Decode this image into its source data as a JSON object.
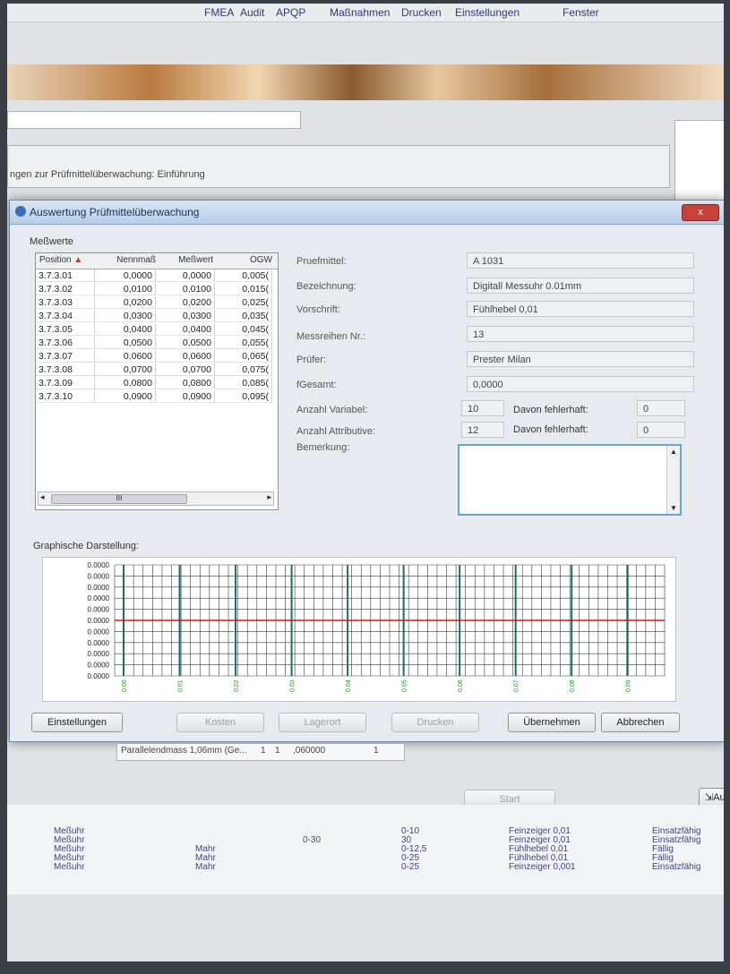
{
  "menubar": {
    "items": [
      "Fenster",
      "Einstellungen",
      "Drucken",
      "Maßnahmen",
      "APQP",
      "Audit",
      "FMEA"
    ]
  },
  "background": {
    "intro_text": "ngen zur Prüfmittelüberwachung: Einführung",
    "row_text": "Parallelendmass 1,06mm (Ge...",
    "row_cols": [
      "1",
      "1",
      ",060000",
      "1"
    ],
    "start_button": "Start",
    "aus_button": "Aus",
    "list_rows": [
      [
        "Meßuhr",
        "",
        "",
        "0-10",
        "Feinzeiger 0,01",
        "Einsatzfähig"
      ],
      [
        "Meßuhr",
        "",
        "0-30",
        "30",
        "Feinzeiger 0,01",
        "Einsatzfähig"
      ],
      [
        "Meßuhr",
        "Mahr",
        "",
        "0-12,5",
        "Fühlhebel 0,01",
        "Fällig"
      ],
      [
        "Meßuhr",
        "Mahr",
        "",
        "0-25",
        "Fühlhebel 0,01",
        "Fällig"
      ],
      [
        "Meßuhr",
        "Mahr",
        "",
        "0-25",
        "Feinzeiger 0,001",
        "Einsatzfähig"
      ]
    ]
  },
  "dialog": {
    "title": "Auswertung Prüfmittelüberwachung",
    "close_label": "x",
    "messwerte_label": "Meßwerte",
    "columns": [
      "Position",
      "Nennmaß",
      "Meßwert",
      "OGW"
    ],
    "rows": [
      [
        "3.7.3.01",
        "0,0000",
        "0,0000",
        "0,005("
      ],
      [
        "3.7.3.02",
        "0,0100",
        "0,0100",
        "0,015("
      ],
      [
        "3.7.3.03",
        "0,0200",
        "0,0200",
        "0,025("
      ],
      [
        "3.7.3.04",
        "0,0300",
        "0,0300",
        "0,035("
      ],
      [
        "3.7.3.05",
        "0,0400",
        "0,0400",
        "0,045("
      ],
      [
        "3.7.3.06",
        "0,0500",
        "0,0500",
        "0,055("
      ],
      [
        "3.7.3.07",
        "0,0600",
        "0,0600",
        "0,065("
      ],
      [
        "3.7.3.08",
        "0,0700",
        "0,0700",
        "0,075("
      ],
      [
        "3.7.3.09",
        "0,0800",
        "0,0800",
        "0,085("
      ],
      [
        "3.7.3.10",
        "0,0900",
        "0,0900",
        "0,095("
      ]
    ],
    "scroll_thumb": "III",
    "fields": {
      "pruefmittel_label": "Pruefmittel:",
      "pruefmittel": "A 1031",
      "bezeichnung_label": "Bezeichnung:",
      "bezeichnung": "Digitall Messuhr 0.01mm",
      "vorschrift_label": "Vorschrift:",
      "vorschrift": "Fühlhebel 0,01",
      "messreihe_label": "Messreihen Nr.:",
      "messreihe": "13",
      "pruefer_label": "Prüfer:",
      "pruefer": "Prester Milan",
      "fgesamt_label": "fGesamt:",
      "fgesamt": "0,0000",
      "anzahl_variabel_label": "Anzahl Variabel:",
      "anzahl_variabel": "10",
      "anzahl_attributive_label": "Anzahl Attributive:",
      "anzahl_attributive": "12",
      "davon_label": "Davon fehlerhaft:",
      "davon_variabel": "0",
      "davon_attributive": "0",
      "bemerkung_label": "Bemerkung:"
    },
    "graph_label": "Graphische Darstellung:",
    "buttons": {
      "einstellungen": "Einstellungen",
      "kosten": "Kosten",
      "lagerort": "Lagerort",
      "drucken": "Drucken",
      "uebernehmen": "Übernehmen",
      "abbrechen": "Abbrechen"
    }
  },
  "chart_data": {
    "type": "line",
    "y_tick_labels": [
      "0.0000",
      "0.0000",
      "0.0000",
      "0.0000",
      "0.0000",
      "0.0000",
      "0.0000",
      "0.0000",
      "0.0000",
      "0.0000",
      "0.0000"
    ],
    "x_tick_labels": [
      "0.00",
      "0.01",
      "0.02",
      "0.03",
      "0.04",
      "0.05",
      "0.06",
      "0.07",
      "0.08",
      "0.09"
    ],
    "x": [
      0.0,
      0.01,
      0.02,
      0.03,
      0.04,
      0.05,
      0.06,
      0.07,
      0.08,
      0.09
    ],
    "series": [
      {
        "values": [
          0,
          0,
          0,
          0,
          0,
          0,
          0,
          0,
          0,
          0
        ]
      }
    ],
    "colors": {
      "series": "#d01818",
      "tick_lines": "#1f6b6b",
      "grid": "#3b3b3b"
    }
  }
}
